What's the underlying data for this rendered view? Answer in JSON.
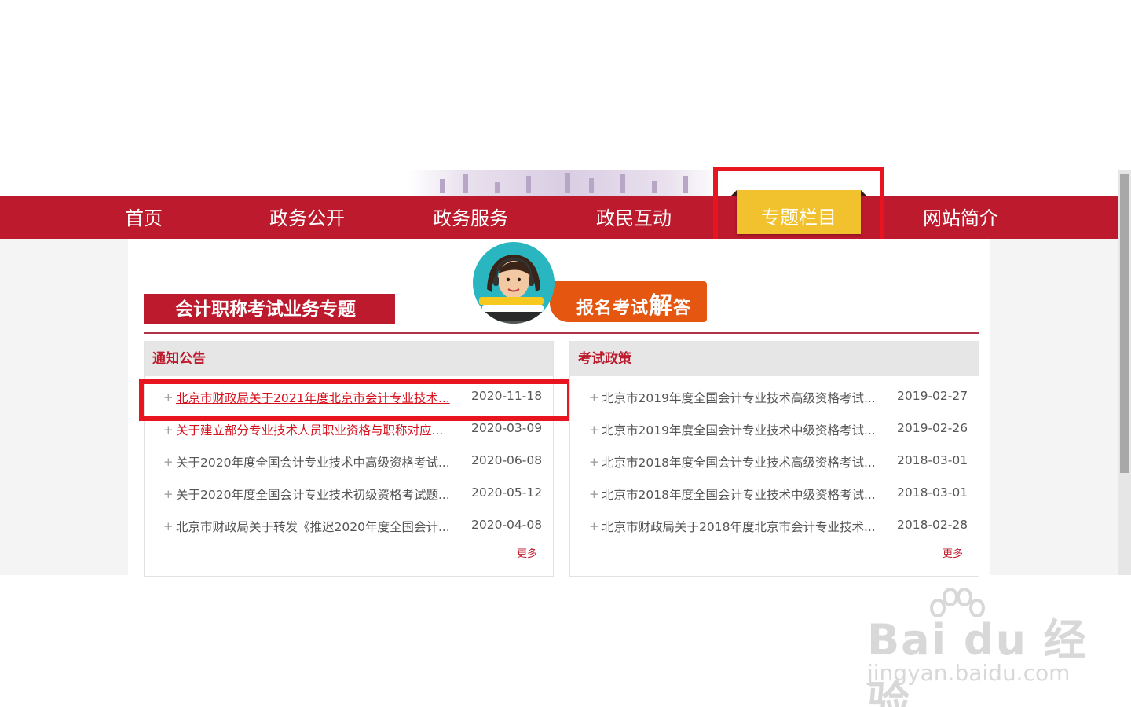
{
  "nav": {
    "items": [
      {
        "label": "首页"
      },
      {
        "label": "政务公开"
      },
      {
        "label": "政务服务"
      },
      {
        "label": "政民互动"
      },
      {
        "label": "专题栏目"
      },
      {
        "label": "网站简介"
      }
    ],
    "active_index": 4
  },
  "topic": {
    "title": "会计职称考试业务专题",
    "banner_text_pre": "报名考试",
    "banner_text_em": "解",
    "banner_text_post": "答"
  },
  "panels": {
    "notices": {
      "title": "通知公告",
      "items": [
        {
          "title": "北京市财政局关于2021年度北京市会计专业技术...",
          "date": "2020-11-18"
        },
        {
          "title": "关于建立部分专业技术人员职业资格与职称对应...",
          "date": "2020-03-09"
        },
        {
          "title": "关于2020年度全国会计专业技术中高级资格考试...",
          "date": "2020-06-08"
        },
        {
          "title": "关于2020年度全国会计专业技术初级资格考试题...",
          "date": "2020-05-12"
        },
        {
          "title": "北京市财政局关于转发《推迟2020年度全国会计...",
          "date": "2020-04-08"
        }
      ],
      "more": "更多"
    },
    "policies": {
      "title": "考试政策",
      "items": [
        {
          "title": "北京市2019年度全国会计专业技术高级资格考试...",
          "date": "2019-02-27"
        },
        {
          "title": "北京市2019年度全国会计专业技术中级资格考试...",
          "date": "2019-02-26"
        },
        {
          "title": "北京市2018年度全国会计专业技术高级资格考试...",
          "date": "2018-03-01"
        },
        {
          "title": "北京市2018年度全国会计专业技术中级资格考试...",
          "date": "2018-03-01"
        },
        {
          "title": "北京市财政局关于2018年度北京市会计专业技术...",
          "date": "2018-02-28"
        }
      ],
      "more": "更多"
    }
  },
  "watermark": {
    "brand": "Bai du 经验",
    "url": "jingyan.baidu.com"
  },
  "colors": {
    "brand_red": "#bd1a2d",
    "active_tab": "#f2c12e",
    "annotation_red": "#e8141f",
    "banner_orange": "#e55610",
    "banner_teal": "#2ab6c1"
  }
}
